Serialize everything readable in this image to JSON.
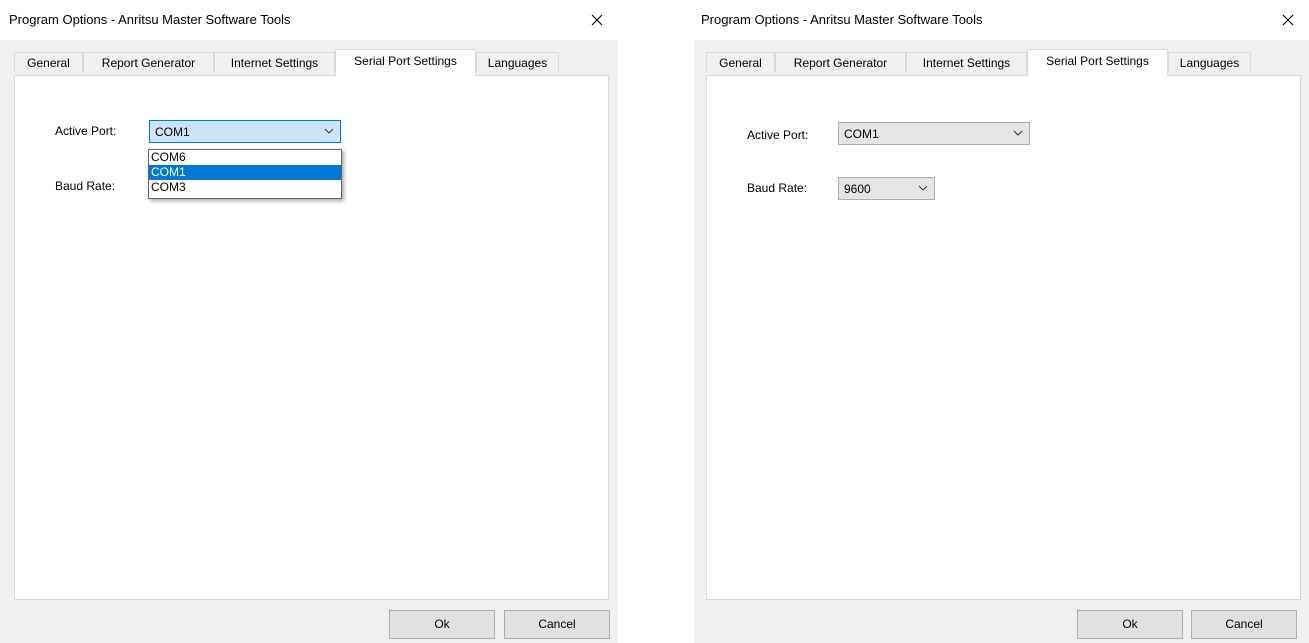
{
  "window_title": "Program Options - Anritsu Master Software Tools",
  "tabs": [
    "General",
    "Report Generator",
    "Internet Settings",
    "Serial Port Settings",
    "Languages"
  ],
  "active_tab": "Serial Port Settings",
  "labels": {
    "active_port": "Active Port:",
    "baud_rate": "Baud Rate:"
  },
  "left": {
    "active_port_value": "COM1",
    "port_options": [
      "COM6",
      "COM1",
      "COM3"
    ],
    "selected_option": "COM1"
  },
  "right": {
    "active_port_value": "COM1",
    "baud_rate_value": "9600"
  },
  "buttons": {
    "ok": "Ok",
    "cancel": "Cancel"
  },
  "icons": {
    "close": "close-icon",
    "dropdown": "chevron-down-icon"
  },
  "colors": {
    "accent": "#0078d7",
    "focus_fill": "#cce4f7"
  }
}
